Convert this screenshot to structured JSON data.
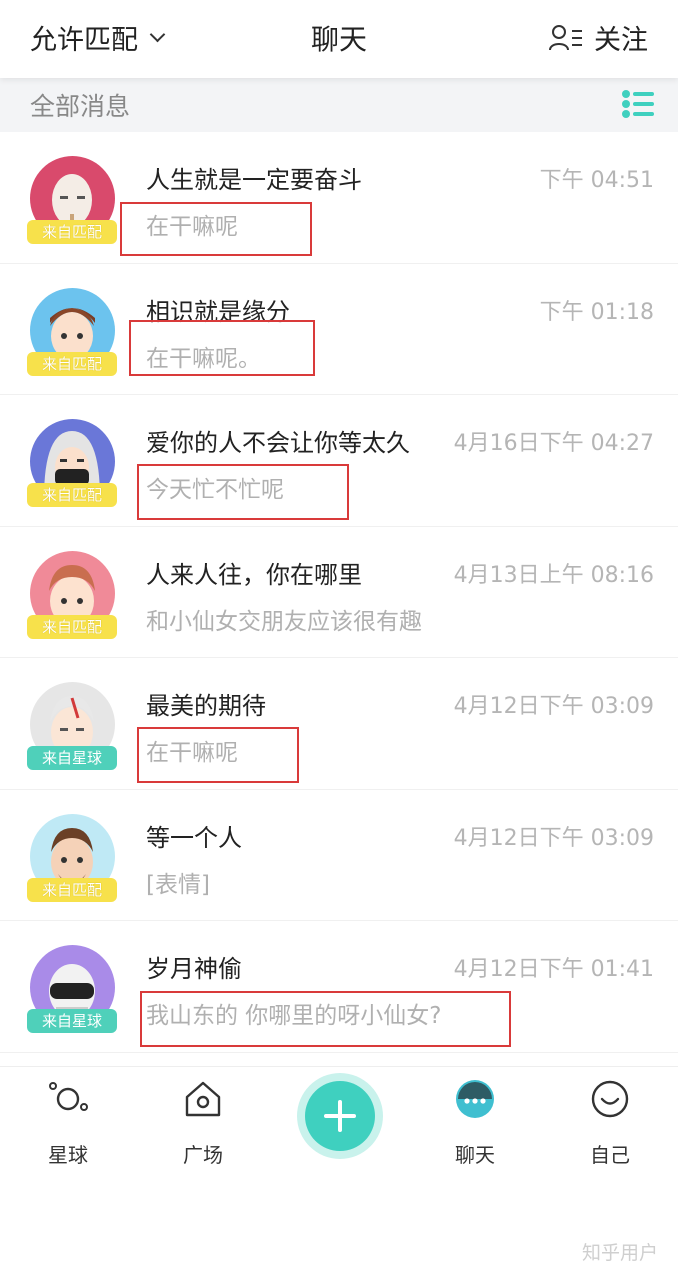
{
  "header": {
    "left_label": "允许匹配",
    "title": "聊天",
    "right_label": "关注"
  },
  "section": {
    "label": "全部消息"
  },
  "chats": [
    {
      "name": "人生就是一定要奋斗",
      "time": "下午 04:51",
      "message": "在干嘛呢",
      "badge": "来自匹配",
      "badge_type": "yellow",
      "avatar_bg": "#d94a6c"
    },
    {
      "name": "相识就是缘分",
      "time": "下午 01:18",
      "message": "在干嘛呢。",
      "badge": "来自匹配",
      "badge_type": "yellow",
      "avatar_bg": "#6cc3ee"
    },
    {
      "name": "爱你的人不会让你等太久",
      "time": "4月16日下午 04:27",
      "message": "今天忙不忙呢",
      "badge": "来自匹配",
      "badge_type": "yellow",
      "avatar_bg": "#6a77d8"
    },
    {
      "name": "人来人往，你在哪里",
      "time": "4月13日上午 08:16",
      "message": "和小仙女交朋友应该很有趣",
      "badge": "来自匹配",
      "badge_type": "yellow",
      "avatar_bg": "#f08a98"
    },
    {
      "name": "最美的期待",
      "time": "4月12日下午 03:09",
      "message": "在干嘛呢",
      "badge": "来自星球",
      "badge_type": "green",
      "avatar_bg": "#e6e6e6"
    },
    {
      "name": "等一个人",
      "time": "4月12日下午 03:09",
      "message": "[表情]",
      "badge": "来自匹配",
      "badge_type": "yellow",
      "avatar_bg": "#bfe9f5"
    },
    {
      "name": "岁月神偷",
      "time": "4月12日下午 01:41",
      "message": "我山东的 你哪里的呀小仙女?",
      "badge": "来自星球",
      "badge_type": "green",
      "avatar_bg": "#a98be8"
    }
  ],
  "nav": {
    "planet": "星球",
    "square": "广场",
    "chat": "聊天",
    "me": "自己"
  },
  "watermark": "知乎用户",
  "colors": {
    "accent": "#3fd0bf",
    "highlight_box": "#d93a3a"
  }
}
